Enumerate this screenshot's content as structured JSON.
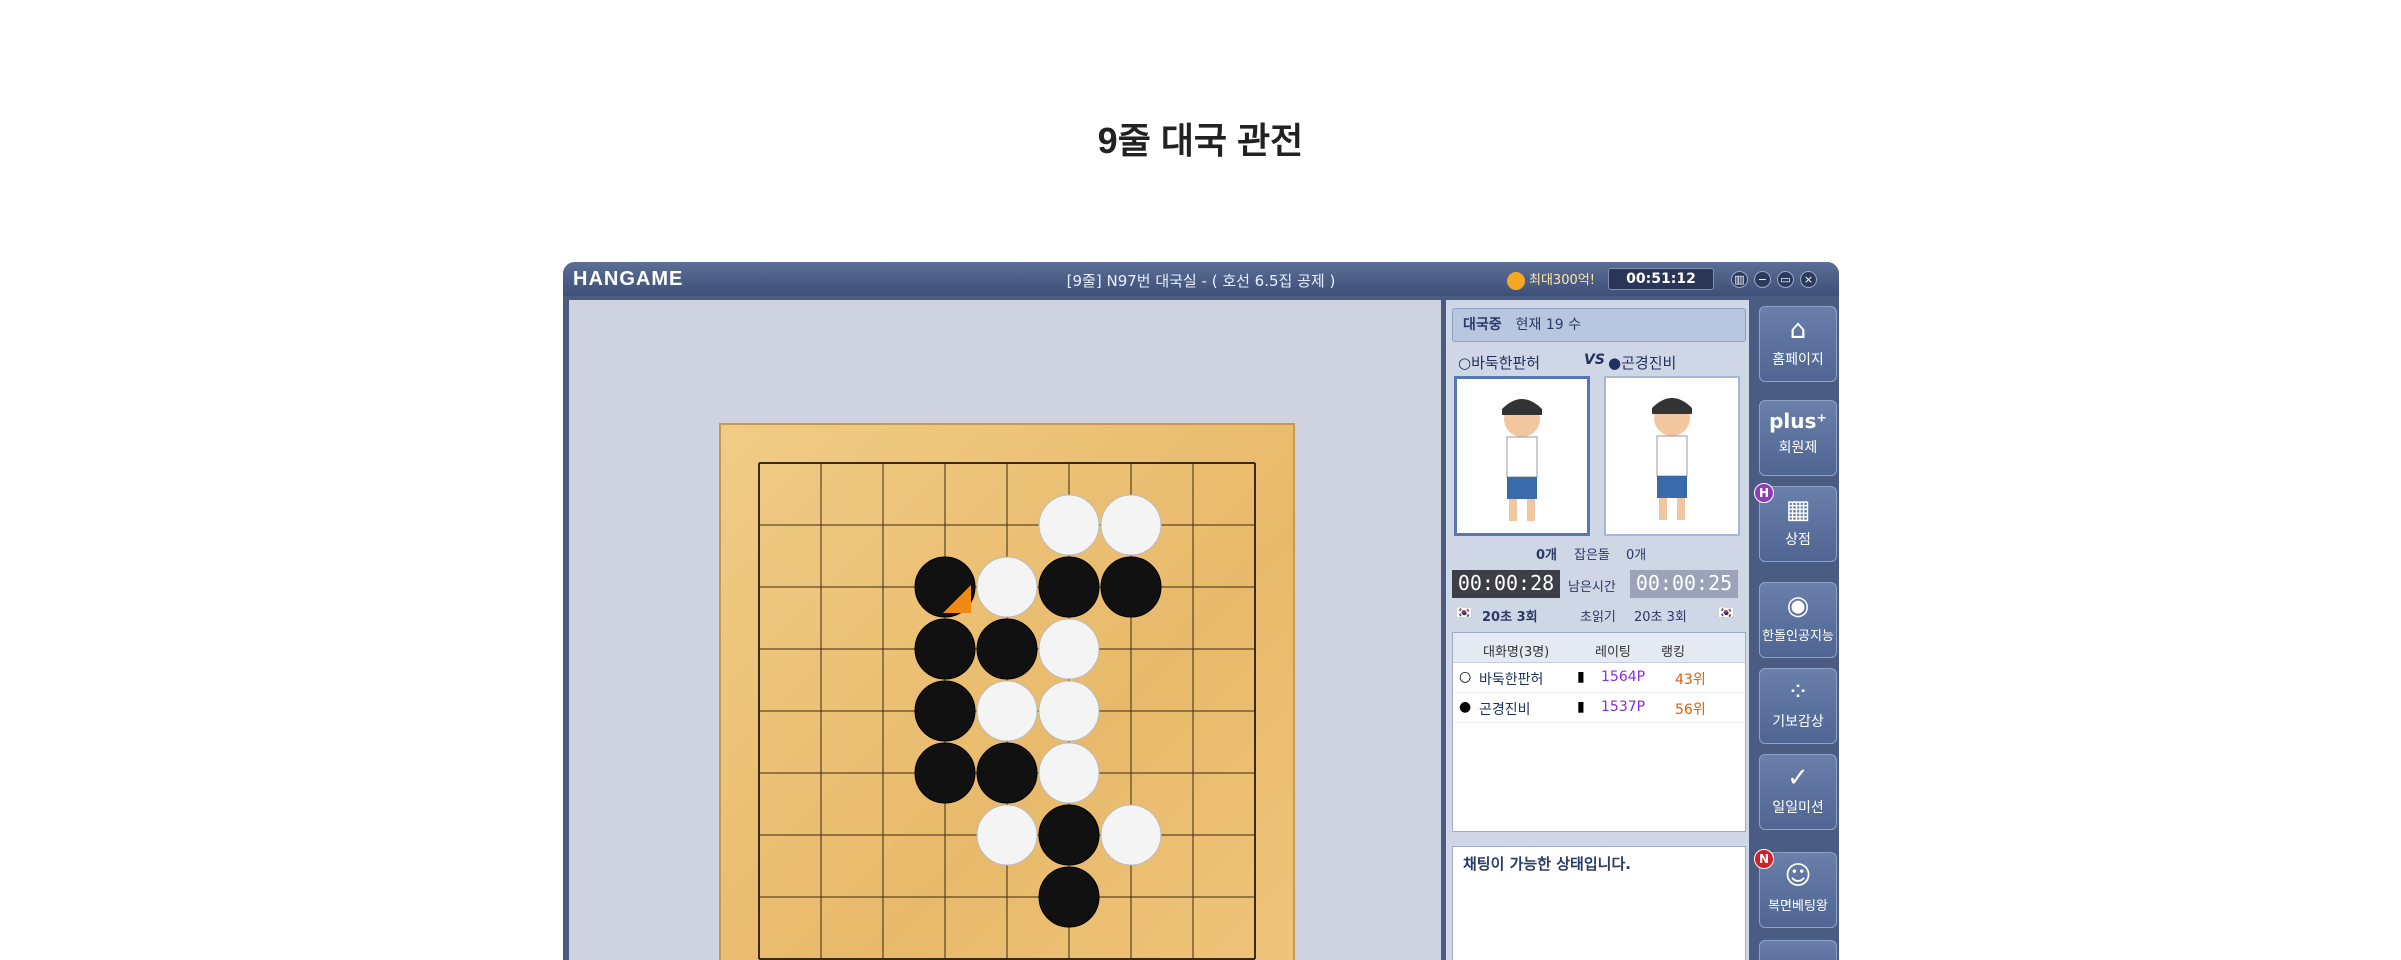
{
  "page": {
    "title": "9줄 대국 관전"
  },
  "window": {
    "logo": "HANGAME",
    "room_title": "[9줄] N97번 대국실  - ( 호선 6.5집 공제 )",
    "promo": "최대300억!",
    "clock": "00:51:12",
    "buttons": [
      "▥",
      "−",
      "▭",
      "×"
    ]
  },
  "board": {
    "size": 9,
    "stones": [
      {
        "color": "white",
        "col": 5,
        "row": 1
      },
      {
        "color": "white",
        "col": 6,
        "row": 1
      },
      {
        "color": "black",
        "col": 3,
        "row": 2,
        "last": true
      },
      {
        "color": "white",
        "col": 4,
        "row": 2
      },
      {
        "color": "black",
        "col": 5,
        "row": 2
      },
      {
        "color": "black",
        "col": 6,
        "row": 2
      },
      {
        "color": "black",
        "col": 3,
        "row": 3
      },
      {
        "color": "black",
        "col": 4,
        "row": 3
      },
      {
        "color": "white",
        "col": 5,
        "row": 3
      },
      {
        "color": "black",
        "col": 3,
        "row": 4
      },
      {
        "color": "white",
        "col": 4,
        "row": 4
      },
      {
        "color": "white",
        "col": 5,
        "row": 4
      },
      {
        "color": "black",
        "col": 3,
        "row": 5
      },
      {
        "color": "black",
        "col": 4,
        "row": 5
      },
      {
        "color": "white",
        "col": 5,
        "row": 5
      },
      {
        "color": "white",
        "col": 4,
        "row": 6
      },
      {
        "color": "black",
        "col": 5,
        "row": 6
      },
      {
        "color": "white",
        "col": 6,
        "row": 6
      },
      {
        "color": "black",
        "col": 5,
        "row": 7
      }
    ]
  },
  "status": {
    "state": "대국중",
    "move": "현재 19 수"
  },
  "players": {
    "white_name": "바둑한판허",
    "black_name": "곤경진비",
    "vs": "VS"
  },
  "info": {
    "captured_left": "0개",
    "captured_label": "잡은돌",
    "captured_right": "0개",
    "time_left": "00:00:28",
    "time_label": "남은시간",
    "time_right": "00:00:25",
    "byoyomi_left": "20초 3회",
    "byoyomi_label": "초읽기",
    "byoyomi_right": "20초 3회"
  },
  "chat_list": {
    "headers": [
      "대화명(3명)",
      "레이팅",
      "랭킹"
    ],
    "rows": [
      {
        "name": "바둑한판허",
        "rating": "1564P",
        "rank": "43위"
      },
      {
        "name": "곤경진비",
        "rating": "1537P",
        "rank": "56위"
      }
    ]
  },
  "chat_message": "채팅이 가능한 상태입니다.",
  "menu": [
    {
      "label": "홈페이지",
      "glyph": "⌂"
    },
    {
      "label": "회원제",
      "glyph": "plus⁺"
    },
    {
      "label": "상점",
      "glyph": "▦",
      "badge": "H"
    },
    {
      "label": "한돌인공지능",
      "glyph": "◉"
    },
    {
      "label": "기보감상",
      "glyph": "⁘"
    },
    {
      "label": "일일미션",
      "glyph": "✓"
    },
    {
      "label": "복면베팅왕",
      "glyph": "☺",
      "badge": "N"
    }
  ],
  "colors": {
    "accent": "#4a5c82",
    "rating": "#8a2be2",
    "rank": "#e06000"
  }
}
